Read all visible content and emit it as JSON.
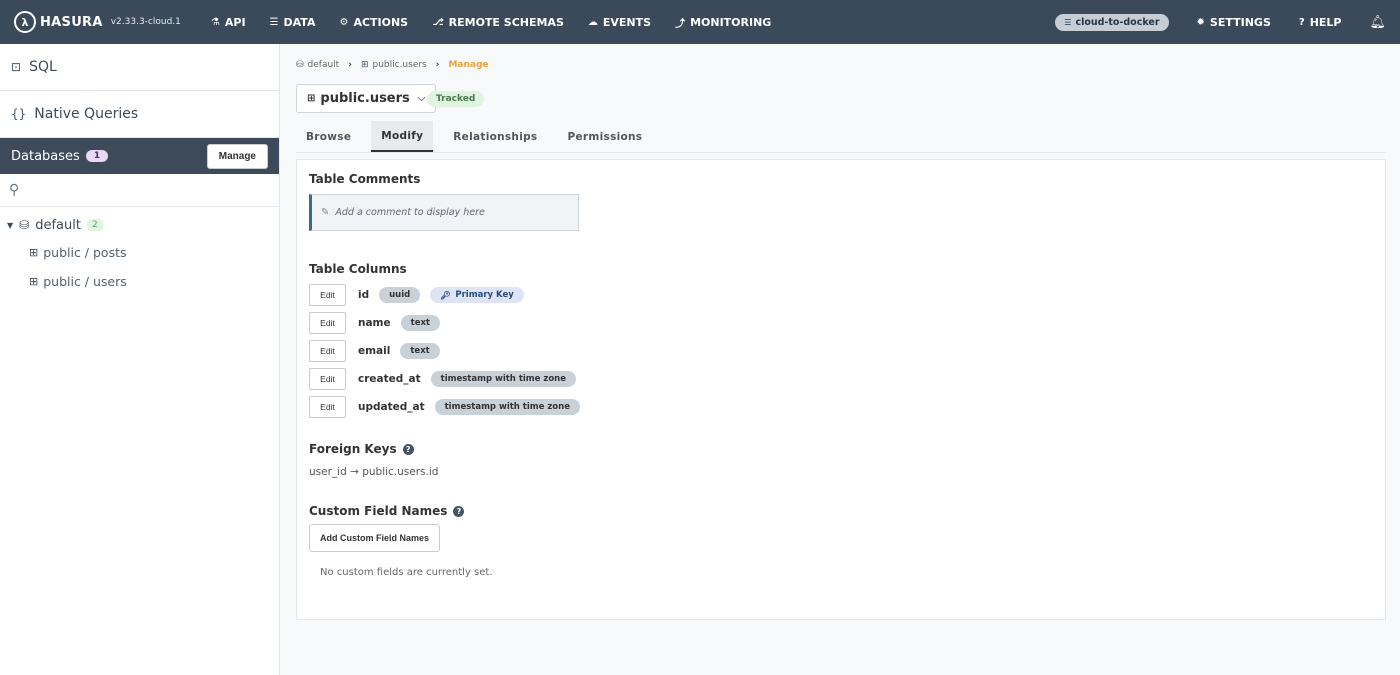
{
  "topnav": {
    "brand": "HASURA",
    "version": "v2.33.3-cloud.1",
    "items": [
      {
        "icon": "flask-icon",
        "glyph": "⚗",
        "label": "API"
      },
      {
        "icon": "database-icon",
        "glyph": "☰",
        "label": "DATA"
      },
      {
        "icon": "actions-icon",
        "glyph": "⚙",
        "label": "ACTIONS"
      },
      {
        "icon": "plug-icon",
        "glyph": "⎇",
        "label": "REMOTE SCHEMAS"
      },
      {
        "icon": "cloud-icon",
        "glyph": "☁",
        "label": "EVENTS"
      },
      {
        "icon": "chart-icon",
        "glyph": "⤴",
        "label": "MONITORING"
      }
    ],
    "project": "cloud-to-docker",
    "settings": "SETTINGS",
    "help": "HELP"
  },
  "sidebar": {
    "sql": "SQL",
    "native_queries": "Native Queries",
    "databases_label": "Databases",
    "databases_count": "1",
    "manage": "Manage",
    "db_name": "default",
    "schema_count": "2",
    "tables": [
      "public / posts",
      "public / users"
    ]
  },
  "main": {
    "breadcrumb": {
      "db": "default",
      "table": "public.users",
      "current": "Manage"
    },
    "table_name": "public.users",
    "tracked": "Tracked",
    "tabs": [
      "Browse",
      "Modify",
      "Relationships",
      "Permissions"
    ],
    "active_tab": "Modify",
    "table_comments_title": "Table Comments",
    "comment_placeholder": "Add a comment to display here",
    "table_columns_title": "Table Columns",
    "edit_label": "Edit",
    "columns": [
      {
        "name": "id",
        "type": "uuid",
        "primary_key": "Primary Key"
      },
      {
        "name": "name",
        "type": "text"
      },
      {
        "name": "email",
        "type": "text"
      },
      {
        "name": "created_at",
        "type": "timestamp with time zone"
      },
      {
        "name": "updated_at",
        "type": "timestamp with time zone"
      }
    ],
    "foreign_keys_title": "Foreign Keys",
    "foreign_key": "user_id → public.users.id",
    "custom_fields_title": "Custom Field Names",
    "add_custom_fields": "Add Custom Field Names",
    "no_custom_fields": "No custom fields are currently set."
  },
  "colors": {
    "nav_bg": "#3a4a5a",
    "accent": "#e8a33c",
    "tracked_bg": "#e0f4e2"
  }
}
